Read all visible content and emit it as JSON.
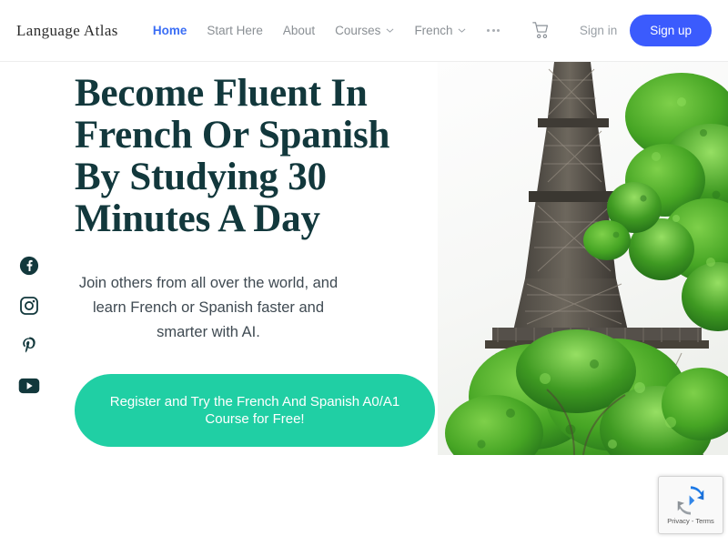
{
  "header": {
    "logo": "Language Atlas",
    "nav": [
      {
        "label": "Home",
        "active": true,
        "has_dropdown": false
      },
      {
        "label": "Start Here",
        "active": false,
        "has_dropdown": false
      },
      {
        "label": "About",
        "active": false,
        "has_dropdown": false
      },
      {
        "label": "Courses",
        "active": false,
        "has_dropdown": true
      },
      {
        "label": "French",
        "active": false,
        "has_dropdown": true
      }
    ],
    "more_icon": "ellipsis-icon",
    "cart_icon": "shopping-cart-icon",
    "sign_in_label": "Sign in",
    "sign_up_label": "Sign up",
    "active_color": "#3b6ef5",
    "signup_bg": "#3b5bfd"
  },
  "social": [
    {
      "name": "facebook",
      "label": "Facebook"
    },
    {
      "name": "instagram",
      "label": "Instagram"
    },
    {
      "name": "pinterest",
      "label": "Pinterest"
    },
    {
      "name": "youtube",
      "label": "YouTube"
    }
  ],
  "hero": {
    "headline": "Become Fluent In French Or Spanish By Studying 30 Minutes A Day",
    "subheadline": "Join others from all over the world, and learn French or Spanish faster and smarter with AI.",
    "cta_label": "Register and Try the French And Spanish A0/A1 Course for Free!",
    "cta_bg": "#20cfa4",
    "headline_color": "#12383c",
    "image_alt": "eiffel-tower-with-green-foliage"
  },
  "recaptcha": {
    "text": "Privacy - Terms",
    "logo": "recaptcha-logo-icon"
  }
}
